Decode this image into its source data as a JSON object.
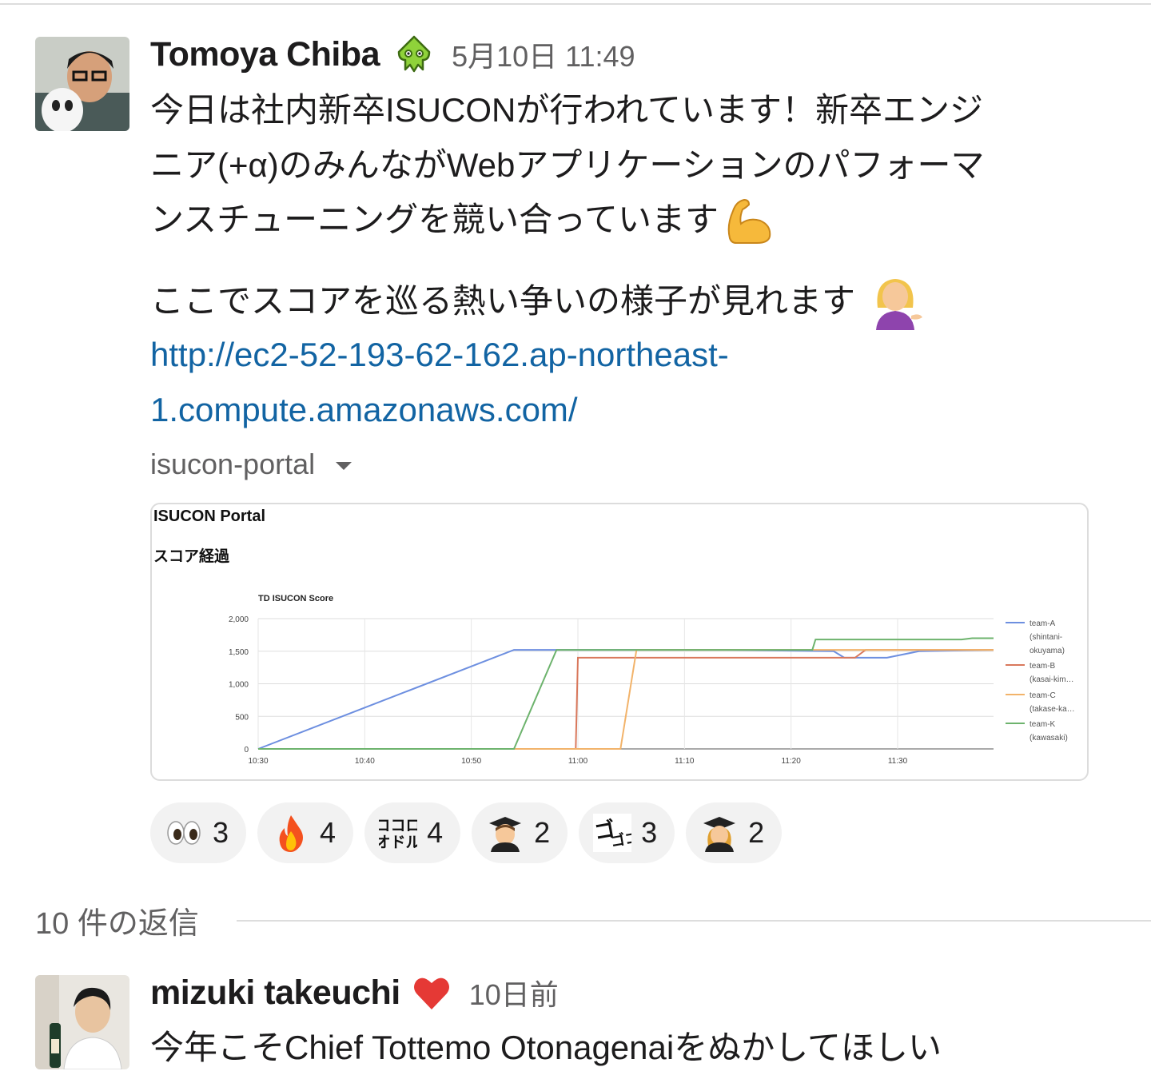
{
  "message": {
    "author": "Tomoya Chiba",
    "status_icon": "squid-icon",
    "timestamp": "5月10日 11:49",
    "lines": [
      "今日は社内新卒ISUCONが行われています！新卒エンジ",
      "ニア(+α)のみんながWebアプリケーションのパフォーマ",
      "ンスチューニングを競い合っています"
    ],
    "line2": "ここでスコアを巡る熱い争いの様子が見れます",
    "link_lines": [
      "http://ec2-52-193-62-162.ap-northeast-",
      "1.compute.amazonaws.com/"
    ],
    "attachment": {
      "source": "isucon-portal",
      "title": "ISUCON Portal",
      "subtitle": "スコア経過"
    },
    "reactions": [
      {
        "icon": "eyes-icon",
        "count": "3"
      },
      {
        "icon": "fire-icon",
        "count": "4"
      },
      {
        "icon": "kokoro-odoru-icon",
        "count": "4"
      },
      {
        "icon": "man-graduate-icon",
        "count": "2"
      },
      {
        "icon": "gogogo-icon",
        "count": "3"
      },
      {
        "icon": "woman-graduate-icon",
        "count": "2"
      }
    ]
  },
  "replies": {
    "label": "10 件の返信"
  },
  "reply": {
    "author": "mizuki takeuchi",
    "status_icon": "heart-icon",
    "timestamp": "10日前",
    "text": "今年こそChief Tottemo Otonagenaiをぬかしてほしい"
  },
  "chart_data": {
    "type": "line",
    "title": "TD ISUCON Score",
    "xlabel": "",
    "ylabel": "",
    "x_ticks": [
      "10:30",
      "10:40",
      "10:50",
      "11:00",
      "11:10",
      "11:20",
      "11:30"
    ],
    "y_ticks": [
      "0",
      "500",
      "1,000",
      "1,500",
      "2,000"
    ],
    "ylim": [
      0,
      2000
    ],
    "xlim_minutes": [
      0,
      69
    ],
    "grid": true,
    "legend": "right",
    "series": [
      {
        "name": "team-A (shintani-okuyama)",
        "color": "#6d8fe0",
        "points": [
          [
            0,
            0
          ],
          [
            24,
            1520
          ],
          [
            44,
            1520
          ],
          [
            54,
            1500
          ],
          [
            55,
            1400
          ],
          [
            59,
            1400
          ],
          [
            62,
            1500
          ],
          [
            69,
            1520
          ]
        ]
      },
      {
        "name": "team-B (kasai-kim…",
        "color": "#d9785c",
        "points": [
          [
            0,
            0
          ],
          [
            29.8,
            0
          ],
          [
            30,
            1400
          ],
          [
            53,
            1400
          ],
          [
            56,
            1400
          ],
          [
            57,
            1520
          ],
          [
            69,
            1520
          ]
        ]
      },
      {
        "name": "team-C (takase-ka…",
        "color": "#f2b36a",
        "points": [
          [
            0,
            0
          ],
          [
            34,
            0
          ],
          [
            35.5,
            1520
          ],
          [
            69,
            1520
          ]
        ]
      },
      {
        "name": "team-K (kawasaki)",
        "color": "#6db36d",
        "points": [
          [
            0,
            0
          ],
          [
            24,
            0
          ],
          [
            28,
            1520
          ],
          [
            45,
            1520
          ],
          [
            52,
            1520
          ],
          [
            52.3,
            1680
          ],
          [
            66,
            1680
          ],
          [
            67,
            1700
          ],
          [
            69,
            1700
          ]
        ]
      }
    ]
  }
}
